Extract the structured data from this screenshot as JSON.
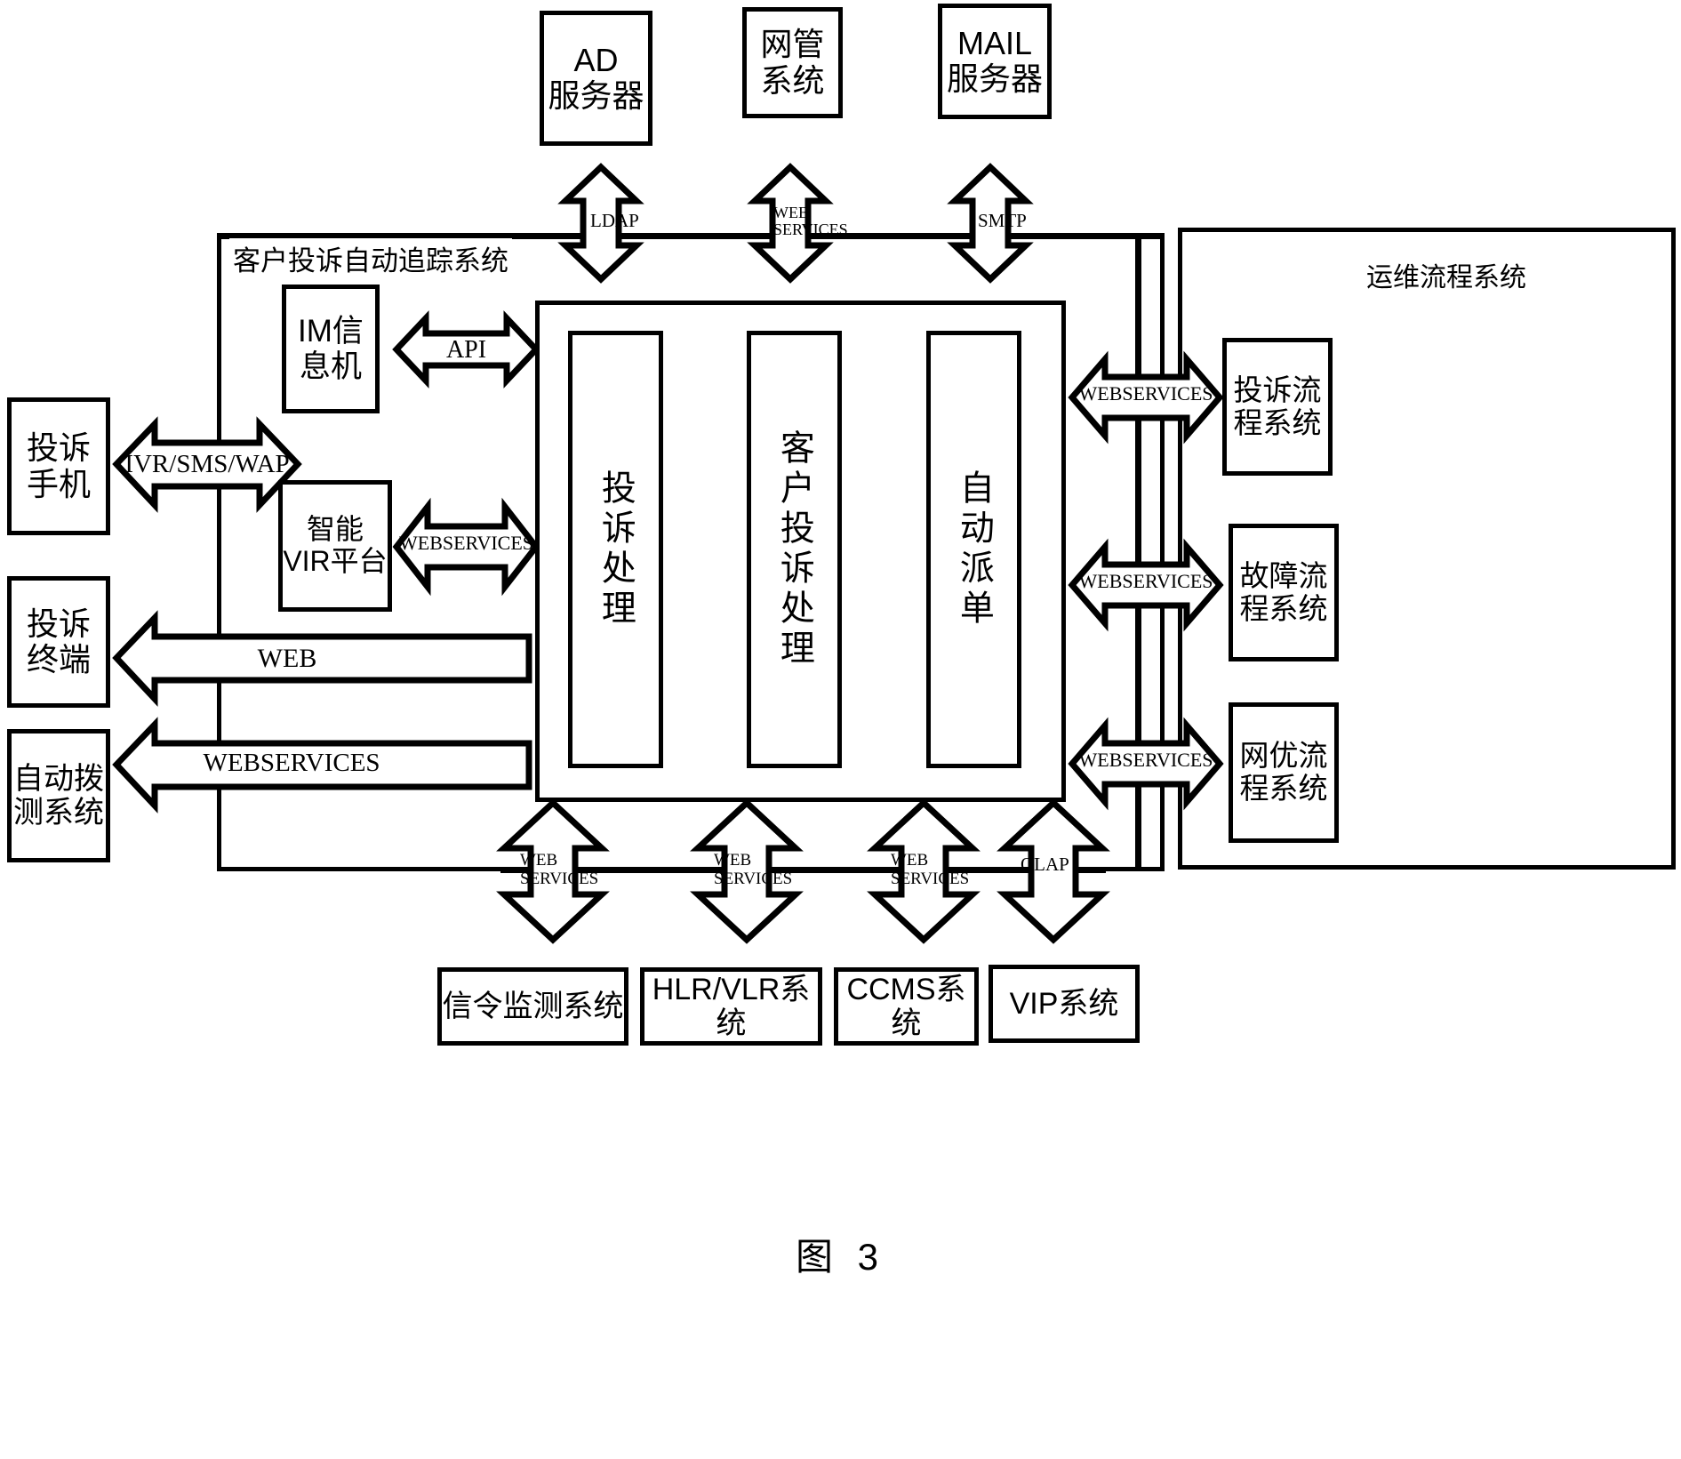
{
  "figure": {
    "caption": "图 3"
  },
  "containers": {
    "tracking_system": {
      "label": "客户投诉自动追踪系统"
    },
    "om_process_system": {
      "label": "运维流程系统"
    }
  },
  "top_systems": [
    {
      "name": "ad-server",
      "label": "AD\n服务器"
    },
    {
      "name": "network-management-system",
      "label": "网管\n系统"
    },
    {
      "name": "mail-server",
      "label": "MAIL\n服务器"
    }
  ],
  "top_connectors": [
    {
      "name": "ldap-connector",
      "label": "LDAP"
    },
    {
      "name": "web-services-connector-nms",
      "label": "WEB\nSERVICES"
    },
    {
      "name": "smtp-connector",
      "label": "SMTP"
    }
  ],
  "left_systems": [
    {
      "name": "complaint-mobile",
      "label": "投诉\n手机"
    },
    {
      "name": "complaint-terminal",
      "label": "投诉\n终端"
    },
    {
      "name": "auto-dial-test-system",
      "label": "自动拨\n测系统"
    }
  ],
  "left_connectors": [
    {
      "name": "ivr-sms-wap-connector",
      "label": "IVR/SMS/WAP"
    },
    {
      "name": "web-connector",
      "label": "WEB"
    },
    {
      "name": "webservices-connector-autodial",
      "label": "WEBSERVICES"
    }
  ],
  "inner_modules": [
    {
      "name": "im-message-machine",
      "label": "IM信\n息机"
    },
    {
      "name": "intelligent-vir-platform",
      "label": "智能\nVIR平台"
    }
  ],
  "inner_connectors": [
    {
      "name": "api-connector",
      "label": "API"
    },
    {
      "name": "webservices-connector-vir",
      "label": "WEBSERVICES"
    }
  ],
  "core_pillars": [
    {
      "name": "complaint-processing",
      "label": "投诉处理"
    },
    {
      "name": "customer-complaint-processing",
      "label": "客户投诉处理"
    },
    {
      "name": "auto-dispatch",
      "label": "自动派单"
    }
  ],
  "right_systems": [
    {
      "name": "complaint-process-system",
      "label": "投诉流\n程系统"
    },
    {
      "name": "fault-process-system",
      "label": "故障流\n程系统"
    },
    {
      "name": "network-optimization-process-system",
      "label": "网优流\n程系统"
    }
  ],
  "right_connectors": [
    {
      "name": "webservices-connector-complaint-flow",
      "label": "WEBSERVICES"
    },
    {
      "name": "webservices-connector-fault-flow",
      "label": "WEBSERVICES"
    },
    {
      "name": "webservices-connector-netopt-flow",
      "label": "WEBSERVICES"
    }
  ],
  "bottom_systems": [
    {
      "name": "signalling-monitoring-system",
      "label": "信令监测系统"
    },
    {
      "name": "hlr-vlr-system",
      "label": "HLR/VLR系统"
    },
    {
      "name": "ccms-system",
      "label": "CCMS系统"
    },
    {
      "name": "vip-system",
      "label": "VIP系统"
    }
  ],
  "bottom_connectors": [
    {
      "name": "webservices-connector-signalling",
      "label": "WEB\nSERVICES"
    },
    {
      "name": "webservices-connector-hlrvlr",
      "label": "WEB\nSERVICES"
    },
    {
      "name": "webservices-connector-ccms",
      "label": "WEB\nSERVICES"
    },
    {
      "name": "olap-connector",
      "label": "OLAP"
    }
  ],
  "colors": {
    "stroke": "#000000",
    "fill": "#ffffff"
  }
}
